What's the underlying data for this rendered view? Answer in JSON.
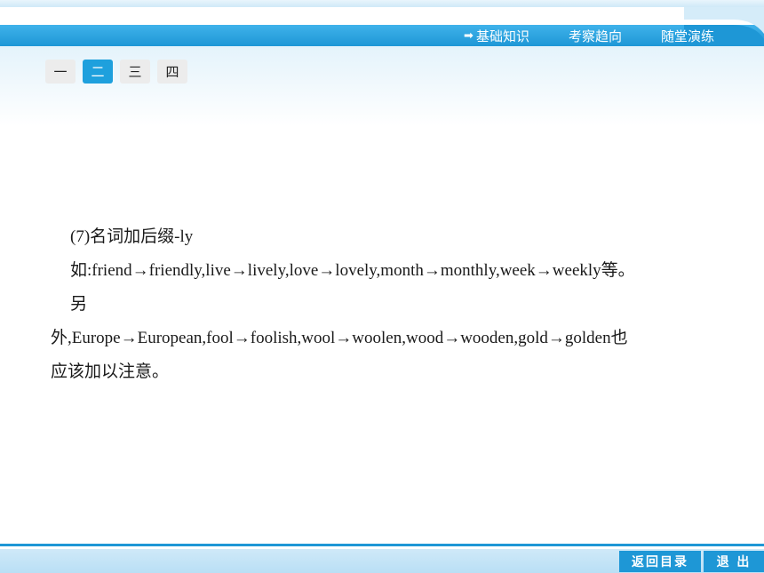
{
  "nav": {
    "arrow_icon": "➡",
    "items": [
      "基础知识",
      "考察趋向",
      "随堂演练"
    ]
  },
  "tabs": [
    "一",
    "二",
    "三",
    "四"
  ],
  "active_tab": 1,
  "content": {
    "line1": "(7)名词加后缀-ly",
    "line2": "如:friend→friendly,live→lively,love→lovely,month→monthly,week→weekly等。",
    "line3": "另",
    "line4": "外,Europe→European,fool→foolish,wool→woolen,wood→wooden,gold→golden也",
    "line5": "应该加以注意。"
  },
  "footer": {
    "back_label": "返回目录",
    "exit_label": "退 出"
  },
  "colors": {
    "accent": "#1e97d6",
    "tab_active": "#1ea0dd",
    "tab_inactive": "#ececec"
  }
}
